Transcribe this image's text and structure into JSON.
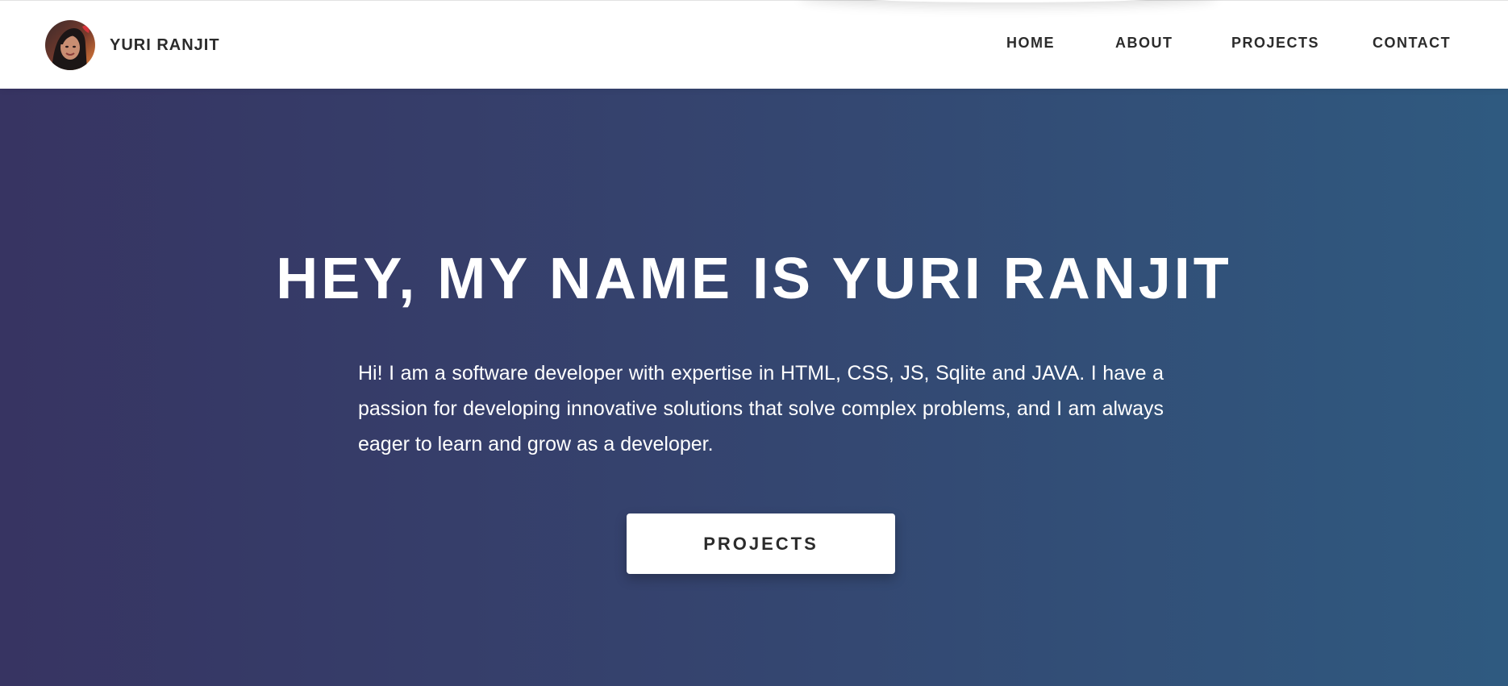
{
  "header": {
    "brand_name": "YURI RANJIT",
    "avatar_icon": "profile-photo",
    "nav": {
      "home": "HOME",
      "about": "ABOUT",
      "projects": "PROJECTS",
      "contact": "CONTACT"
    }
  },
  "hero": {
    "title": "HEY, MY NAME IS YURI RANJIT",
    "description": "Hi! I am a software developer with expertise in HTML, CSS, JS, Sqlite and JAVA. I have a passion for developing innovative solutions that solve complex problems, and I am always eager to learn and grow as a developer.",
    "cta_label": "PROJECTS"
  },
  "colors": {
    "hero_gradient_start": "#373462",
    "hero_gradient_end": "#2f5a80",
    "text_dark": "#2b2b2b",
    "white": "#ffffff"
  }
}
